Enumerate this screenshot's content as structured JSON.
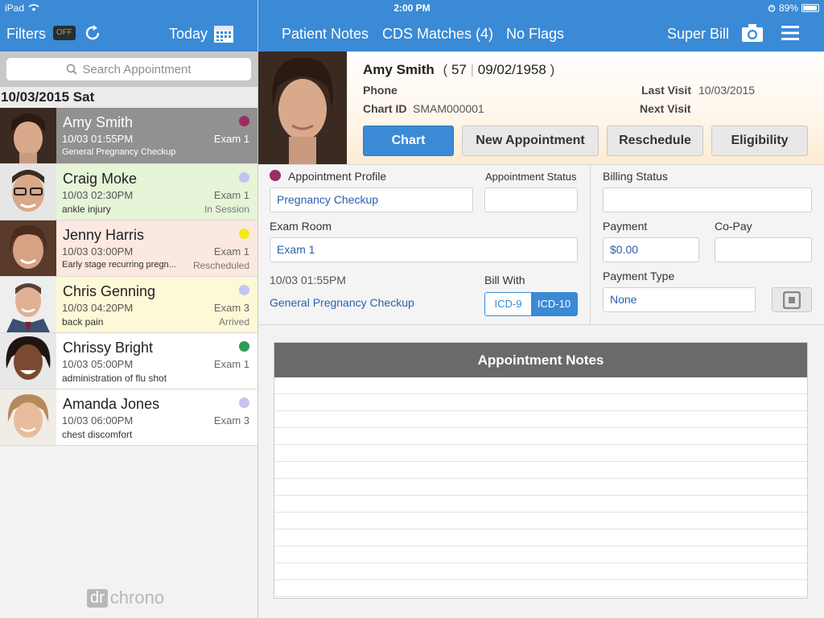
{
  "status_bar": {
    "device": "iPad",
    "time": "2:00 PM",
    "battery": "89%"
  },
  "left_toolbar": {
    "filters_label": "Filters",
    "filter_toggle": "OFF",
    "today_label": "Today"
  },
  "right_toolbar": {
    "patient_notes": "Patient Notes",
    "cds_matches": "CDS Matches (4)",
    "flags": "No Flags",
    "super_bill": "Super Bill"
  },
  "search": {
    "placeholder": "Search Appointment"
  },
  "date_header": "10/03/2015 Sat",
  "appointments": [
    {
      "name": "Amy Smith",
      "time": "10/03 01:55PM",
      "reason": "General Pregnancy Checkup",
      "room": "Exam 1",
      "status": "",
      "dot_color": "#9b2d63",
      "bg": "#919191"
    },
    {
      "name": "Craig Moke",
      "time": "10/03 02:30PM",
      "reason": "ankle injury",
      "room": "Exam 1",
      "status": "In Session",
      "dot_color": "#c5c3f0",
      "bg": "#e6f4d8"
    },
    {
      "name": "Jenny Harris",
      "time": "10/03 03:00PM",
      "reason": "Early stage recurring pregn...",
      "room": "Exam 1",
      "status": "Rescheduled",
      "dot_color": "#f2ea1c",
      "bg": "#fbe8e0"
    },
    {
      "name": "Chris Genning",
      "time": "10/03 04:20PM",
      "reason": "back pain",
      "room": "Exam 3",
      "status": "Arrived",
      "dot_color": "#c5c3f0",
      "bg": "#fdf8d6"
    },
    {
      "name": "Chrissy Bright",
      "time": "10/03 05:00PM",
      "reason": "administration of flu shot",
      "room": "Exam 1",
      "status": "",
      "dot_color": "#2e9a56",
      "bg": "#ffffff"
    },
    {
      "name": "Amanda Jones",
      "time": "10/03 06:00PM",
      "reason": "chest discomfort",
      "room": "Exam 3",
      "status": "",
      "dot_color": "#c5c3f0",
      "bg": "#ffffff"
    }
  ],
  "logo": {
    "part1": "dr",
    "part2": "chrono"
  },
  "patient": {
    "name": "Amy Smith",
    "age": "57",
    "dob": "09/02/1958",
    "phone_label": "Phone",
    "phone": "",
    "chart_id_label": "Chart ID",
    "chart_id": "SMAM000001",
    "last_visit_label": "Last Visit",
    "last_visit": "10/03/2015",
    "next_visit_label": "Next Visit",
    "next_visit": ""
  },
  "actions": {
    "chart": "Chart",
    "new_appointment": "New Appointment",
    "reschedule": "Reschedule",
    "eligibility": "Eligibility"
  },
  "form": {
    "appointment_profile_label": "Appointment Profile",
    "appointment_profile_color": "#9b2d63",
    "appointment_profile": "Pregnancy Checkup",
    "appointment_status_label": "Appointment Status",
    "appointment_status": "",
    "exam_room_label": "Exam Room",
    "exam_room": "Exam 1",
    "datetime": "10/03 01:55PM",
    "visit_reason": "General Pregnancy Checkup",
    "bill_with_label": "Bill With",
    "icd9": "ICD-9",
    "icd10": "ICD-10",
    "billing_status_label": "Billing Status",
    "billing_status": "",
    "payment_label": "Payment",
    "payment": "$0.00",
    "copay_label": "Co-Pay",
    "copay": "",
    "payment_type_label": "Payment Type",
    "payment_type": "None"
  },
  "notes": {
    "title": "Appointment Notes"
  }
}
